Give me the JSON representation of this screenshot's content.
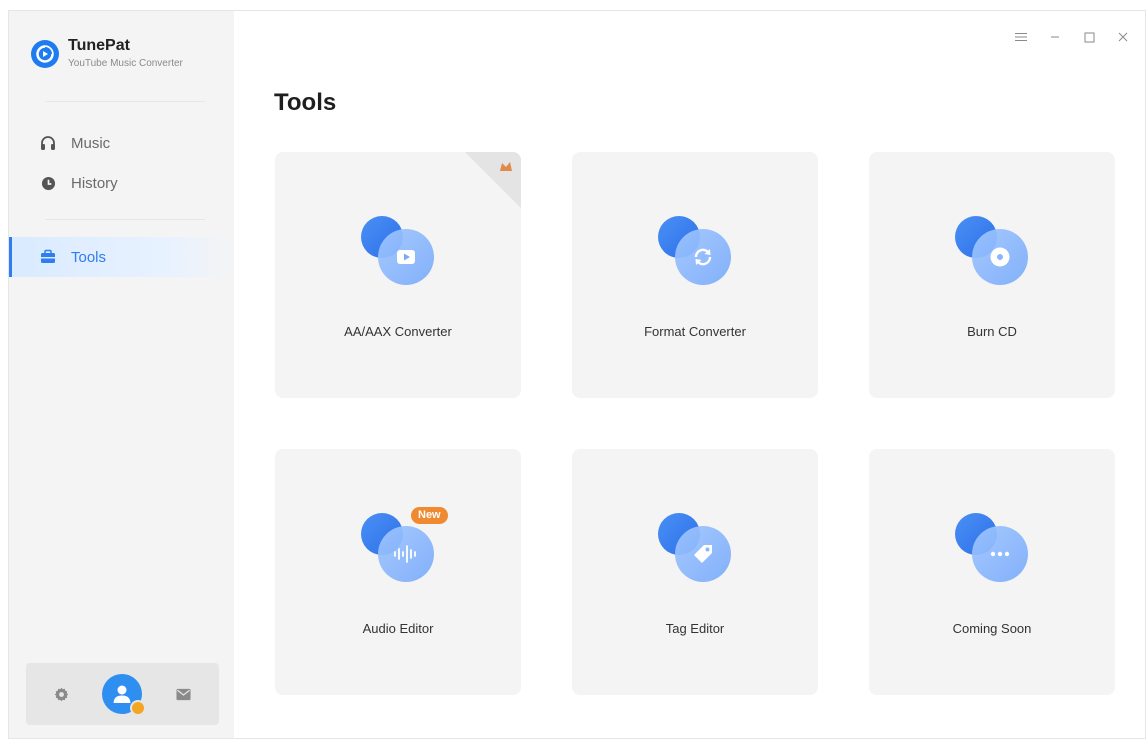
{
  "app": {
    "name": "TunePat",
    "subtitle": "YouTube Music Converter"
  },
  "sidebar": {
    "items": [
      {
        "label": "Music",
        "icon": "headphones-icon"
      },
      {
        "label": "History",
        "icon": "clock-icon"
      },
      {
        "label": "Tools",
        "icon": "toolbox-icon",
        "active": true
      }
    ],
    "bottom": {
      "settings_icon": "gear-icon",
      "account_icon": "user-avatar-icon",
      "mail_icon": "mail-icon"
    }
  },
  "window_controls": [
    "menu-icon",
    "minimize-icon",
    "maximize-icon",
    "close-icon"
  ],
  "main": {
    "title": "Tools",
    "tools": [
      {
        "label": "AA/AAX Converter",
        "icon": "video-play-icon",
        "corner_badge": true
      },
      {
        "label": "Format Converter",
        "icon": "refresh-icon"
      },
      {
        "label": "Burn CD",
        "icon": "disc-icon"
      },
      {
        "label": "Audio Editor",
        "icon": "waveform-icon",
        "badge": "New"
      },
      {
        "label": "Tag Editor",
        "icon": "tag-icon"
      },
      {
        "label": "Coming Soon",
        "icon": "more-icon"
      }
    ]
  },
  "colors": {
    "accent": "#2f7df0",
    "card_bg": "#f4f4f4",
    "sidebar_bg": "#f4f4f4",
    "badge_orange": "#f08a30"
  }
}
